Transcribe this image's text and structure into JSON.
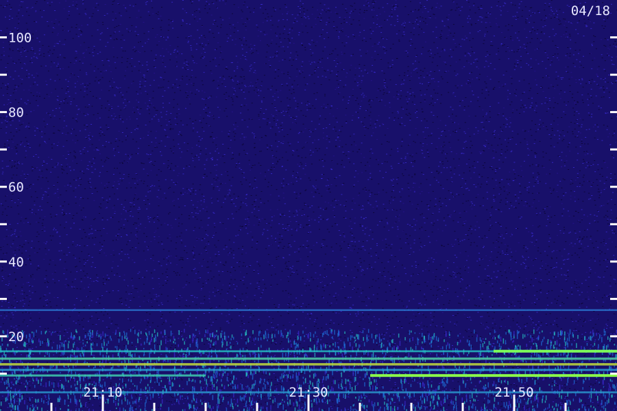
{
  "date_label": "04/18",
  "chart_data": {
    "type": "heatmap",
    "title": "",
    "xlabel": "",
    "ylabel": "",
    "x_range": [
      "21:00",
      "22:00"
    ],
    "ylim": [
      0,
      110
    ],
    "y_ticks": [
      {
        "value": 100,
        "label": "100"
      },
      {
        "value": 90,
        "label": ""
      },
      {
        "value": 80,
        "label": "80"
      },
      {
        "value": 70,
        "label": ""
      },
      {
        "value": 60,
        "label": "60"
      },
      {
        "value": 50,
        "label": ""
      },
      {
        "value": 40,
        "label": "40"
      },
      {
        "value": 30,
        "label": ""
      },
      {
        "value": 20,
        "label": "20"
      },
      {
        "value": 10,
        "label": ""
      }
    ],
    "x_ticks": [
      {
        "value": "21:05",
        "label": ""
      },
      {
        "value": "21:10",
        "label": "21:10"
      },
      {
        "value": "21:15",
        "label": ""
      },
      {
        "value": "21:20",
        "label": ""
      },
      {
        "value": "21:25",
        "label": ""
      },
      {
        "value": "21:30",
        "label": "21:30"
      },
      {
        "value": "21:35",
        "label": ""
      },
      {
        "value": "21:40",
        "label": ""
      },
      {
        "value": "21:45",
        "label": ""
      },
      {
        "value": "21:50",
        "label": "21:50"
      },
      {
        "value": "21:55",
        "label": ""
      }
    ],
    "features": [
      {
        "kind": "band",
        "y": 27,
        "x_start": "21:00",
        "x_end": "22:00",
        "intensity": 0.45,
        "color": "#2a7bd6"
      },
      {
        "kind": "band",
        "y": 16,
        "x_start": "21:00",
        "x_end": "21:48",
        "intensity": 0.5,
        "color": "#27c8c8"
      },
      {
        "kind": "band",
        "y": 16,
        "x_start": "21:48",
        "x_end": "22:00",
        "intensity": 1.0,
        "color": "#7dff5a"
      },
      {
        "kind": "band",
        "y": 14,
        "x_start": "21:00",
        "x_end": "22:00",
        "intensity": 0.75,
        "color": "#4cc4a0"
      },
      {
        "kind": "band",
        "y": 12.5,
        "x_start": "21:00",
        "x_end": "22:00",
        "intensity": 0.8,
        "color": "#b8d040"
      },
      {
        "kind": "band",
        "y": 11,
        "x_start": "21:00",
        "x_end": "22:00",
        "intensity": 0.6,
        "color": "#2aa4d8"
      },
      {
        "kind": "band",
        "y": 9.5,
        "x_start": "21:00",
        "x_end": "21:20",
        "intensity": 0.65,
        "color": "#3fd0b0"
      },
      {
        "kind": "band",
        "y": 9.5,
        "x_start": "21:36",
        "x_end": "22:00",
        "intensity": 1.0,
        "color": "#8cff4a"
      },
      {
        "kind": "band",
        "y": 5,
        "x_start": "21:00",
        "x_end": "22:00",
        "intensity": 0.55,
        "color": "#2a9ad0"
      }
    ],
    "colormap": [
      "#0a0530",
      "#28148e",
      "#3a2bd0",
      "#1e6fd8",
      "#27c8c8",
      "#7dff5a",
      "#ffff60"
    ],
    "grid": false,
    "legend": "none"
  }
}
